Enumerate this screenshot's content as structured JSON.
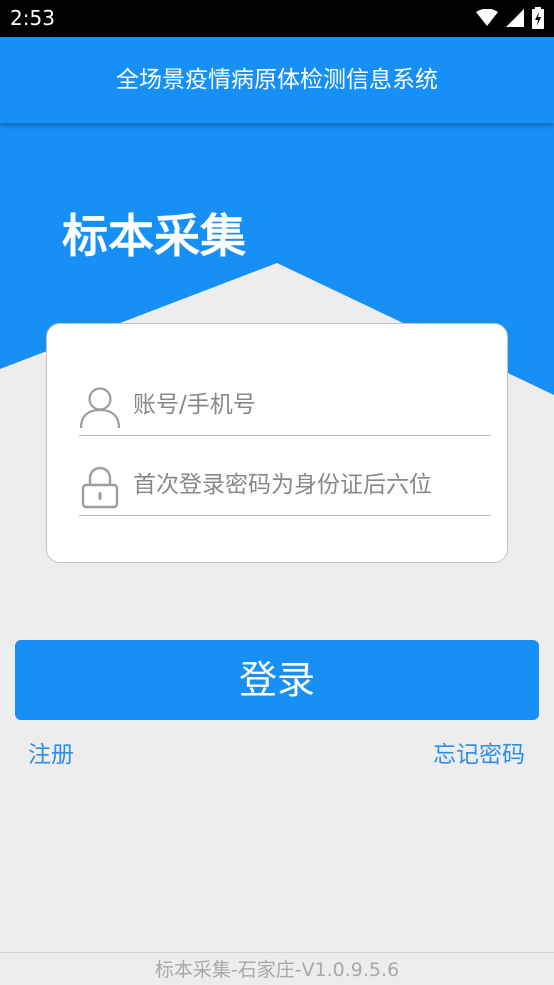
{
  "status_bar": {
    "time": "2:53",
    "icons": [
      "wifi-icon",
      "cellular-signal-icon",
      "battery-charging-icon"
    ]
  },
  "header": {
    "title": "全场景疫情病原体检测信息系统",
    "color": "#1690f6"
  },
  "hero": {
    "title": "标本采集"
  },
  "login_form": {
    "account": {
      "icon": "user-icon",
      "value": "",
      "placeholder": "账号/手机号"
    },
    "password": {
      "icon": "lock-icon",
      "value": "",
      "placeholder": "首次登录密码为身份证后六位"
    }
  },
  "actions": {
    "login_label": "登录",
    "register_label": "注册",
    "forgot_password_label": "忘记密码"
  },
  "footer": {
    "version_text": "标本采集-石家庄-V1.0.9.5.6"
  },
  "colors": {
    "primary": "#1690f6",
    "link": "#2f8ee6",
    "background": "#ededed"
  }
}
